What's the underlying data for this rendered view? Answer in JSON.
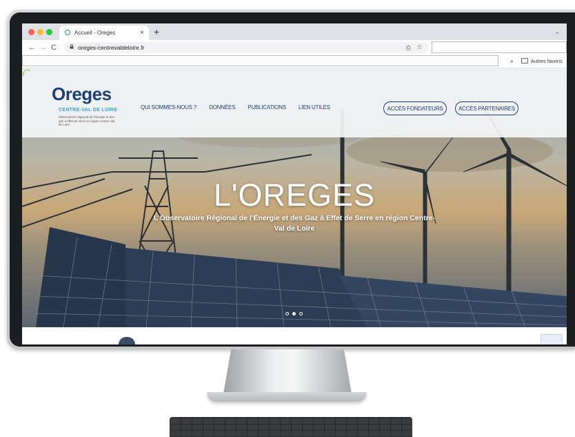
{
  "browser": {
    "tab_title": "Accueil - Oreges",
    "tab_close": "×",
    "new_tab": "+",
    "tab_menu": "⌄",
    "nav_back": "←",
    "nav_forward": "→",
    "nav_reload": "C",
    "url": "oreges-centrevaldeloire.fr",
    "share_icon": "⎙",
    "star_icon": "☆",
    "bookmarks_more": "»",
    "bookmarks_folder": "Autres favoris"
  },
  "site": {
    "logo": {
      "name": "Oreges",
      "subtitle": "CENTRE-VAL DE LOIRE",
      "description": "Observatoire régional de l'énergie et des gaz à effet de serre en région Centre-Val de Loire"
    },
    "menu": [
      "QUI SOMMES-NOUS ?",
      "DONNÉES",
      "PUBLICATIONS",
      "LIEN UTILES"
    ],
    "buttons": {
      "founders": "ACCÈS FONDATEURS",
      "partners": "ACCÈS PARTENAIRES"
    },
    "hero": {
      "title": "L'OREGES",
      "subtitle": "L'Observatoire Régional de l'Énergie et des Gaz à Effet de Serre en région Centre-Val de Loire",
      "slide_count": 3,
      "active_slide": 2
    }
  },
  "colors": {
    "brand_navy": "#1d3f7a",
    "brand_blue": "#3aa3d8",
    "brand_green": "#8cc63f"
  }
}
